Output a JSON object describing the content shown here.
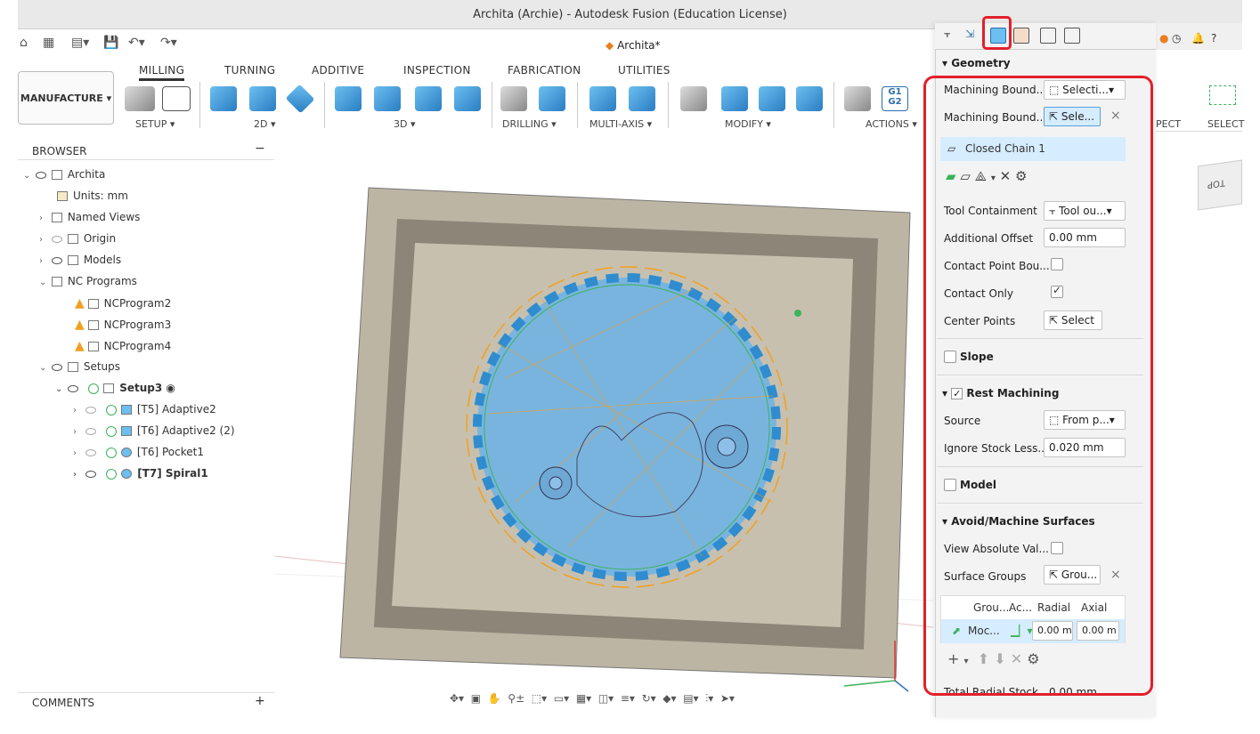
{
  "window": {
    "title": "Archita (Archie) - Autodesk Fusion (Education License)",
    "doc_tab": "Archita*"
  },
  "ribbon": {
    "tabs": [
      "MILLING",
      "TURNING",
      "ADDITIVE",
      "INSPECTION",
      "FABRICATION",
      "UTILITIES"
    ],
    "workspace": "MANUFACTURE",
    "groups": [
      "SETUP",
      "2D",
      "3D",
      "DRILLING",
      "MULTI-AXIS",
      "MODIFY",
      "ACTIONS"
    ],
    "right_groups": [
      "PECT",
      "SELECT"
    ]
  },
  "browser": {
    "header": "BROWSER",
    "items": [
      {
        "label": "Archita"
      },
      {
        "label": "Units: mm"
      },
      {
        "label": "Named Views"
      },
      {
        "label": "Origin"
      },
      {
        "label": "Models"
      },
      {
        "label": "NC Programs"
      },
      {
        "label": "NCProgram2"
      },
      {
        "label": "NCProgram3"
      },
      {
        "label": "NCProgram4"
      },
      {
        "label": "Setups"
      },
      {
        "label": "Setup3"
      },
      {
        "label": "[T5] Adaptive2"
      },
      {
        "label": "[T6] Adaptive2 (2)"
      },
      {
        "label": "[T6] Pocket1"
      },
      {
        "label": "[T7] Spiral1"
      }
    ],
    "comments": "COMMENTS"
  },
  "panel": {
    "geometry": {
      "header": "Geometry",
      "machining_boundary_1_label": "Machining Bound...",
      "machining_boundary_1_value": "Selecti...",
      "machining_boundary_2_label": "Machining Bound...",
      "machining_boundary_2_value": "Sele...",
      "chain_item": "Closed Chain 1",
      "tool_containment_label": "Tool Containment",
      "tool_containment_value": "Tool ou...",
      "additional_offset_label": "Additional Offset",
      "additional_offset_value": "0.00 mm",
      "contact_point_label": "Contact Point Bou...",
      "contact_only_label": "Contact Only",
      "center_points_label": "Center Points",
      "center_points_value": "Select"
    },
    "slope_label": "Slope",
    "rest": {
      "header": "Rest Machining",
      "source_label": "Source",
      "source_value": "From p...",
      "ignore_label": "Ignore Stock Less...",
      "ignore_value": "0.020 mm"
    },
    "model_label": "Model",
    "avoid": {
      "header": "Avoid/Machine Surfaces",
      "view_abs_label": "View Absolute Val...",
      "surface_groups_label": "Surface Groups",
      "surface_groups_value": "Grou...",
      "table_headers": [
        "Grou...",
        "Ac...",
        "Radial",
        "Axial"
      ],
      "row": {
        "group": "Moc...",
        "radial": "0.00 m",
        "axial": "0.00 m"
      },
      "total_radial_label": "Total Radial Stock",
      "total_radial_value": "0.00 mm"
    }
  },
  "viewcube": "TOP",
  "colors": {
    "highlight": "#e2202a",
    "toolpath": "#f0a020",
    "surface": "#6ab4e6"
  }
}
